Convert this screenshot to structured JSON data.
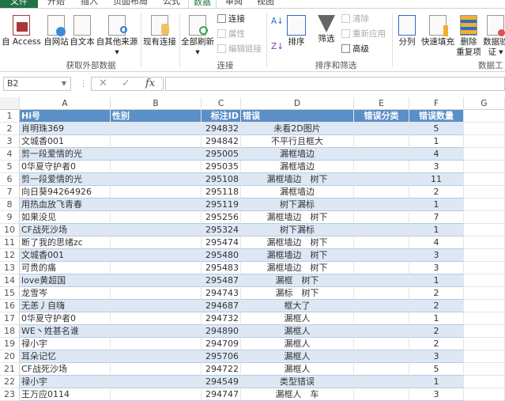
{
  "tabs": [
    "文件",
    "开始",
    "插入",
    "页面布局",
    "公式",
    "数据",
    "审阅",
    "视图"
  ],
  "ribbon": {
    "get_external": {
      "access": "自 Access",
      "web": "自网站",
      "text": "自文本",
      "other": "自其他来源",
      "existing": "现有连接",
      "group": "获取外部数据"
    },
    "connections": {
      "refresh_all": "全部刷新",
      "connections": "连接",
      "properties": "属性",
      "edit_links": "编辑链接",
      "group": "连接"
    },
    "sort_filter": {
      "sort": "排序",
      "filter": "筛选",
      "clear": "清除",
      "reapply": "重新应用",
      "advanced": "高级",
      "group": "排序和筛选"
    },
    "data_tools": {
      "text_to_columns": "分列",
      "flash_fill": "快速填充",
      "remove_dup_1": "删除",
      "remove_dup_2": "重复项",
      "validation_1": "数据验",
      "validation_2": "证 ▾",
      "group": "数据工"
    }
  },
  "formula_bar": {
    "name_box": "B2",
    "fx": "fx",
    "cancel": "✕",
    "enter": "✓",
    "value": ""
  },
  "columns": [
    "A",
    "B",
    "C",
    "D",
    "E",
    "F",
    "G"
  ],
  "header_row": {
    "num": "1",
    "a": "Hi号",
    "b": "性别",
    "c": "标注ID",
    "d": "错误",
    "e": "错误分类",
    "f": "错误数量"
  },
  "rows": [
    [
      "2",
      "肖明珠369",
      "294832",
      "未看2D图片",
      "5"
    ],
    [
      "3",
      "文城香001",
      "294842",
      "不平行且框大",
      "1"
    ],
    [
      "4",
      "剪一段爱情的光",
      "295005",
      "漏框墙边",
      "4"
    ],
    [
      "5",
      "0华夏守护者0",
      "295035",
      "漏框墙边",
      "3"
    ],
    [
      "6",
      "剪一段爱情的光",
      "295108",
      "漏框墙边　树下",
      "11"
    ],
    [
      "7",
      "向日葵94264926",
      "295118",
      "漏框墙边",
      "2"
    ],
    [
      "8",
      "用热血放飞青春",
      "295119",
      "树下漏标",
      "1"
    ],
    [
      "9",
      "如果没见",
      "295256",
      "漏框墙边　树下",
      "7"
    ],
    [
      "10",
      "CF战死沙场",
      "295324",
      "树下漏标",
      "1"
    ],
    [
      "11",
      "断了我的思绪zc",
      "295474",
      "漏框墙边　树下",
      "4"
    ],
    [
      "12",
      "文城香001",
      "295480",
      "漏框墙边　树下",
      "3"
    ],
    [
      "13",
      "可贵的痛",
      "295483",
      "漏框墙边　树下",
      "3"
    ],
    [
      "14",
      "love黄超国",
      "295487",
      "漏框　树下",
      "1"
    ],
    [
      "15",
      "龙雪岑",
      "294743",
      "漏标　树下",
      "2"
    ],
    [
      "16",
      "无恙丿自嗨",
      "294687",
      "框大了",
      "2"
    ],
    [
      "17",
      "0华夏守护者0",
      "294732",
      "漏框人",
      "1"
    ],
    [
      "18",
      "WE丶姓甚名谁",
      "294890",
      "漏框人",
      "2"
    ],
    [
      "19",
      "禄小宇",
      "294709",
      "漏框人",
      "2"
    ],
    [
      "20",
      "耳朵记忆",
      "295706",
      "漏框人",
      "3"
    ],
    [
      "21",
      "CF战死沙场",
      "294722",
      "漏框人",
      "5"
    ],
    [
      "22",
      "禄小宇",
      "294549",
      "类型错误",
      "1"
    ],
    [
      "23",
      "王万应0114",
      "294747",
      "漏框人　车",
      "3"
    ]
  ]
}
